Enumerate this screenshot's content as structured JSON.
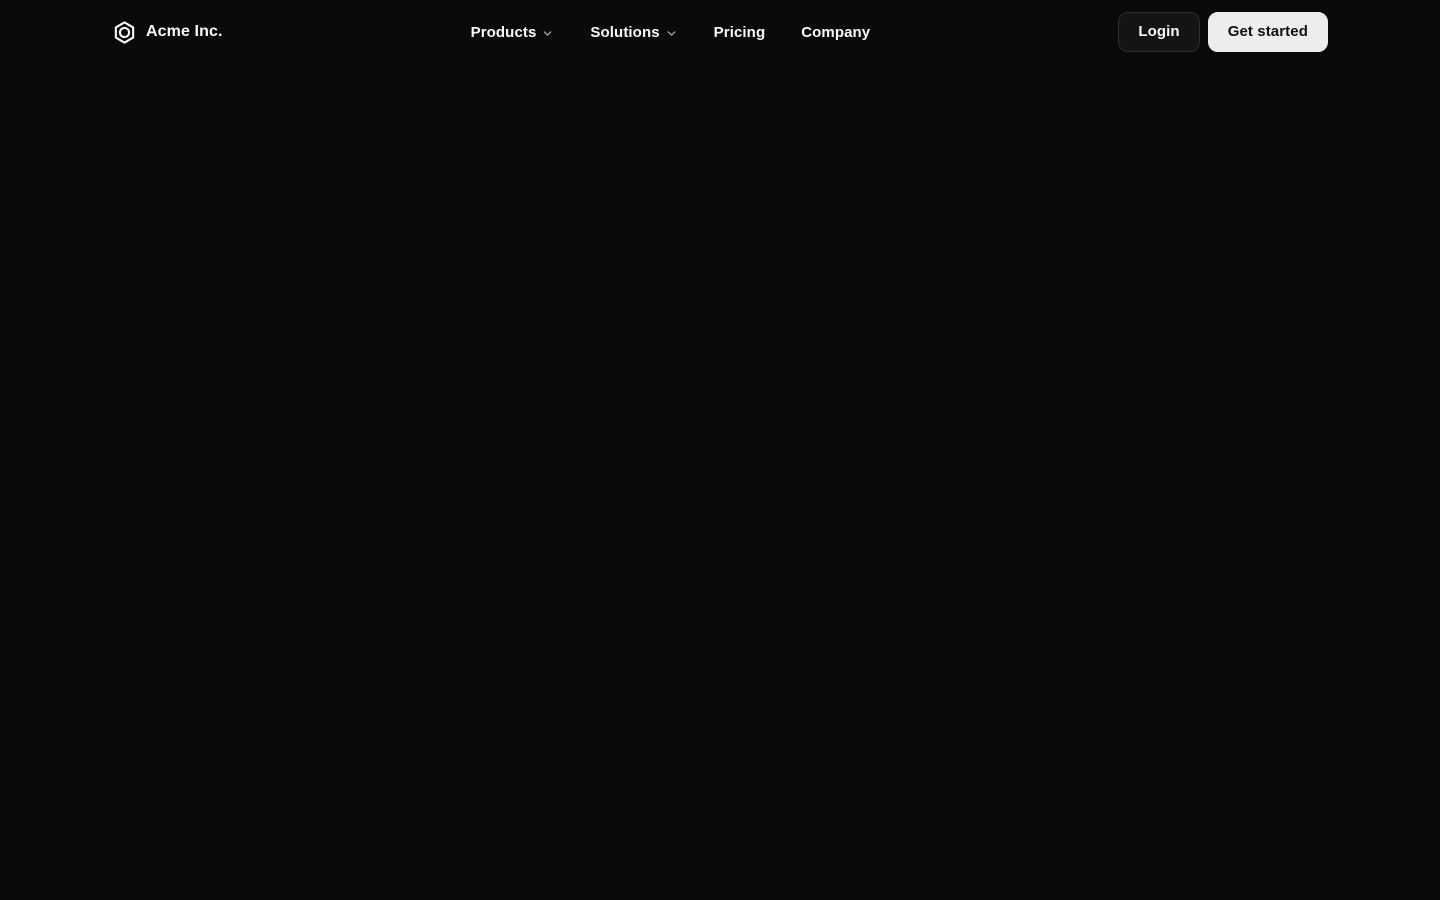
{
  "brand": {
    "name": "Acme Inc.",
    "logo_icon": "hexagon-ring-icon"
  },
  "nav": {
    "items": [
      {
        "label": "Products",
        "has_dropdown": true
      },
      {
        "label": "Solutions",
        "has_dropdown": true
      },
      {
        "label": "Pricing",
        "has_dropdown": false
      },
      {
        "label": "Company",
        "has_dropdown": false
      }
    ]
  },
  "actions": {
    "login_label": "Login",
    "get_started_label": "Get started"
  },
  "colors": {
    "background": "#0a0a0a",
    "text": "#fafafa",
    "chevron_muted": "#9a9aa0",
    "login_button_bg": "#141417",
    "login_button_border": "#2e2e32",
    "cta_button_bg": "#ededed",
    "cta_button_text": "#111111"
  }
}
